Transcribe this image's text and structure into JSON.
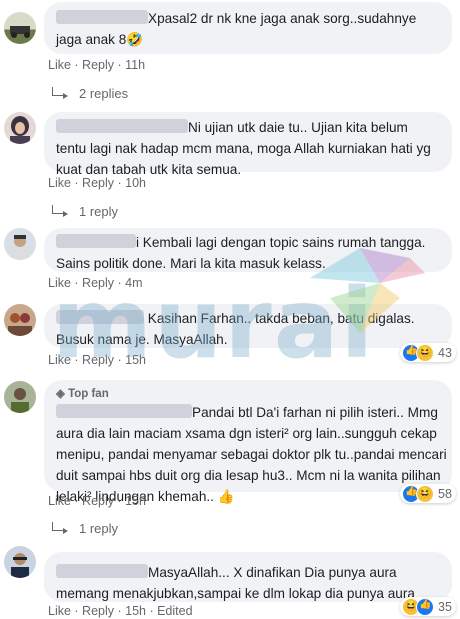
{
  "comments": [
    {
      "text_lines": [
        "Xpasal2 dr nk kne jaga anak sorg..sudahnye",
        "jaga anak 8🤣"
      ],
      "actions": {
        "like": "Like",
        "reply": "Reply",
        "time": "11h"
      },
      "replies_label": "2 replies"
    },
    {
      "text_lines": [
        "Ni ujian utk daie tu.. Ujian kita belum",
        "tentu lagi nak hadap mcm mana, moga Allah kurniakan hati yg",
        "kuat dan tabah utk kita semua."
      ],
      "actions": {
        "like": "Like",
        "reply": "Reply",
        "time": "10h"
      },
      "replies_label": "1 reply"
    },
    {
      "text_lines": [
        "i Kembali lagi dengan topic sains rumah tangga.",
        "Sains politik done. Mari la kita masuk kelass."
      ],
      "actions": {
        "like": "Like",
        "reply": "Reply",
        "time": "4m"
      }
    },
    {
      "text_lines": [
        "Kasihan Farhan.. takda beban, batu digalas.",
        "Busuk nama je. MasyaAllah."
      ],
      "actions": {
        "like": "Like",
        "reply": "Reply",
        "time": "15h"
      },
      "reaction_count": "43"
    },
    {
      "badge": "Top fan",
      "text_lines": [
        "Pandai btl Da'i farhan ni pilih isteri.. Mmg",
        "aura dia lain maciam xsama dgn isteri² org lain..sungguh cekap",
        "menipu, pandai menyamar sebagai doktor plk tu..pandai mencari",
        "duit sampai hbs duit org dia lesap hu3.. Mcm ni la wanita pilihan",
        "lelaki² lindungan khemah.. 👍"
      ],
      "actions": {
        "like": "Like",
        "reply": "Reply",
        "time": "15h"
      },
      "reaction_count": "58",
      "replies_label": "1 reply"
    },
    {
      "text_lines": [
        "MasyaAllah... X dinafikan Dia punya aura",
        "memang menakjubkan,sampai ke dlm lokap dia punya aura"
      ],
      "actions": {
        "like": "Like",
        "reply": "Reply",
        "time": "15h",
        "edited": "Edited"
      },
      "reaction_count": "35"
    }
  ],
  "watermark": "murai",
  "colors": {
    "bubble": "#f0f2f5",
    "meta": "#65676b",
    "like_blue": "#1877f2",
    "haha_yellow": "#f7c136"
  }
}
